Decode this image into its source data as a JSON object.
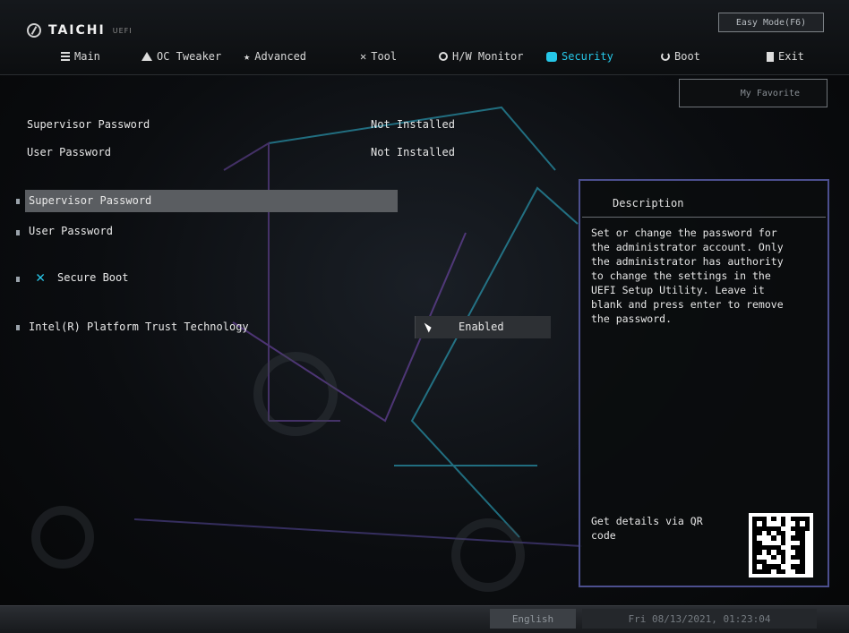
{
  "header": {
    "brand": "TAICHI",
    "brand_sub": "UEFI",
    "easy_mode": "Easy Mode(F6)",
    "favorite": "My Favorite"
  },
  "nav": {
    "tabs": [
      {
        "label": "Main",
        "icon": "list-icon"
      },
      {
        "label": "OC Tweaker",
        "icon": "warning-triangle-icon"
      },
      {
        "label": "Advanced",
        "icon": "star-icon"
      },
      {
        "label": "Tool",
        "icon": "tools-icon"
      },
      {
        "label": "H/W Monitor",
        "icon": "monitor-icon"
      },
      {
        "label": "Security",
        "icon": "shield-icon",
        "active": true
      },
      {
        "label": "Boot",
        "icon": "power-icon"
      },
      {
        "label": "Exit",
        "icon": "exit-icon"
      }
    ]
  },
  "status": {
    "supervisor_label": "Supervisor Password",
    "supervisor_value": "Not Installed",
    "user_label": "User Password",
    "user_value": "Not Installed"
  },
  "menu": {
    "items": [
      {
        "label": "Supervisor Password",
        "selected": true
      },
      {
        "label": "User Password"
      },
      {
        "label": "Secure Boot",
        "icon": "tools-icon"
      },
      {
        "label": "Intel(R) Platform Trust Technology",
        "value": "Enabled"
      }
    ]
  },
  "description": {
    "title": "Description",
    "text": "Set or change the password for\nthe administrator account. Only\nthe administrator has authority\nto change the settings in the\nUEFI Setup Utility. Leave it\nblank and press enter to remove\nthe password.",
    "qr_text": "Get details via QR\ncode"
  },
  "footer": {
    "language": "English",
    "datetime": "Fri 08/13/2021, 01:23:04"
  },
  "colors": {
    "accent": "#26c7e8",
    "panel_border": "#4c4f8e",
    "selected_row": "#5a5d61"
  }
}
